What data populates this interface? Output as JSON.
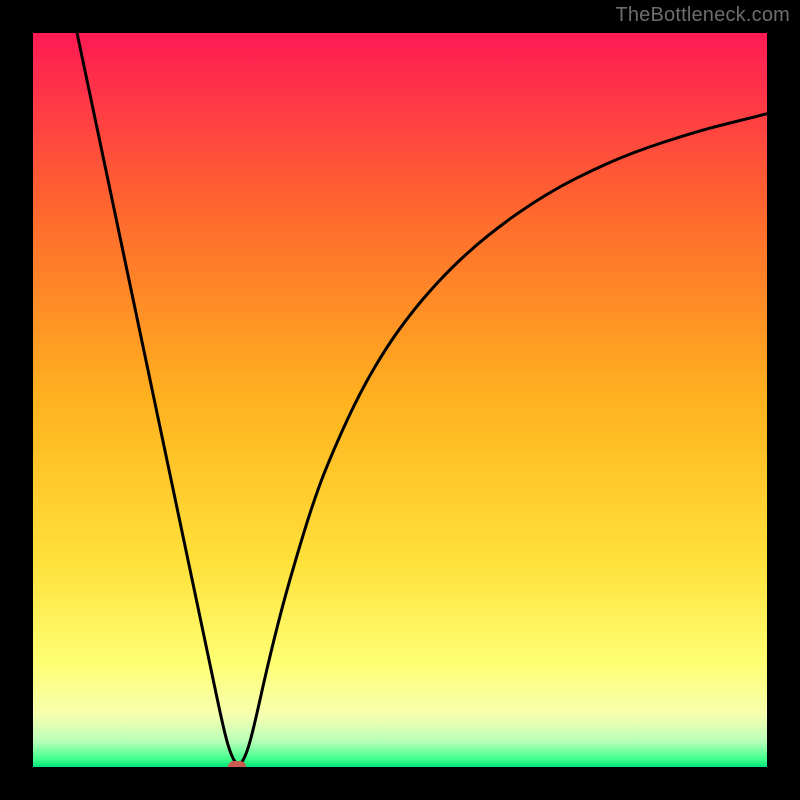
{
  "watermark": "TheBottleneck.com",
  "chart_data": {
    "type": "line",
    "title": "",
    "xlabel": "",
    "ylabel": "",
    "xlim": [
      0,
      100
    ],
    "ylim": [
      0,
      100
    ],
    "grid": false,
    "legend": false,
    "background_gradient": {
      "stops": [
        {
          "offset": 0.0,
          "color": "#ff1a55"
        },
        {
          "offset": 0.25,
          "color": "#ff6a2d"
        },
        {
          "offset": 0.5,
          "color": "#ffb21e"
        },
        {
          "offset": 0.72,
          "color": "#ffe13a"
        },
        {
          "offset": 0.86,
          "color": "#ffff74"
        },
        {
          "offset": 0.93,
          "color": "#f6ffb0"
        },
        {
          "offset": 0.965,
          "color": "#b8ffb8"
        },
        {
          "offset": 0.99,
          "color": "#3cff8a"
        },
        {
          "offset": 1.0,
          "color": "#00e27a"
        }
      ]
    },
    "series": [
      {
        "name": "bottleneck-curve",
        "color": "#000000",
        "x": [
          6,
          8,
          10,
          12,
          14,
          16,
          18,
          20,
          22,
          24,
          26,
          27,
          28,
          29,
          30,
          32,
          34,
          36,
          38,
          40,
          44,
          48,
          52,
          56,
          60,
          64,
          68,
          72,
          76,
          80,
          84,
          88,
          92,
          96,
          100
        ],
        "y": [
          100,
          90.5,
          81,
          71.5,
          62,
          52.5,
          43,
          33.5,
          24,
          14.5,
          5,
          1.5,
          0,
          1.5,
          5,
          14,
          22,
          29,
          35.5,
          41,
          50,
          57,
          62.5,
          67,
          70.8,
          74,
          76.8,
          79.2,
          81.2,
          83,
          84.5,
          85.8,
          87,
          88,
          89
        ]
      }
    ],
    "marker": {
      "x": 27.8,
      "y": 0,
      "color": "#ca5b4d"
    }
  }
}
